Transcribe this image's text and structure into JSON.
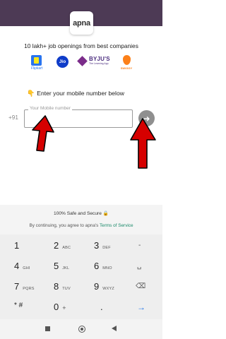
{
  "app": {
    "logo_text": "apna"
  },
  "tagline": "10 lakh+ job openings from best companies",
  "companies": [
    {
      "name": "Flipkart",
      "color": "#2874f0"
    },
    {
      "name": "Jio",
      "color": "#0f3cc9"
    },
    {
      "name": "BYJU'S",
      "subtitle": "The Learning App",
      "color": "#4b2d7f"
    },
    {
      "name": "SWIGGY",
      "color": "#fc8019"
    }
  ],
  "login": {
    "prompt_icon": "pointing-hand-emoji",
    "prompt": "Enter your mobile number below",
    "country_code": "+91",
    "mobile_label": "Your Mobile number",
    "mobile_value": "",
    "submit_icon": "arrow-right-icon"
  },
  "consent": {
    "safe_text": "100% Safe and Secure",
    "lock_icon": "lock-icon",
    "terms_prefix": "By continuing, you agree to apna's",
    "terms_link": "Terms of Service"
  },
  "keypad": {
    "keys": [
      {
        "digit": "1",
        "letters": ""
      },
      {
        "digit": "2",
        "letters": "ABC"
      },
      {
        "digit": "3",
        "letters": "DEF"
      },
      {
        "digit": "-",
        "letters": ""
      },
      {
        "digit": "4",
        "letters": "GHI"
      },
      {
        "digit": "5",
        "letters": "JKL"
      },
      {
        "digit": "6",
        "letters": "MNO"
      },
      {
        "digit": "␣",
        "letters": ""
      },
      {
        "digit": "7",
        "letters": "PQRS"
      },
      {
        "digit": "8",
        "letters": "TUV"
      },
      {
        "digit": "9",
        "letters": "WXYZ"
      },
      {
        "digit": "⌫",
        "letters": ""
      },
      {
        "digit": "* #",
        "letters": ""
      },
      {
        "digit": "0",
        "letters": "+"
      },
      {
        "digit": ".",
        "letters": ""
      },
      {
        "digit": "→",
        "letters": ""
      }
    ]
  },
  "annotations": {
    "arrow_color": "#d60000"
  },
  "navbar": {
    "recents_icon": "square-icon",
    "home_icon": "circle-home-icon",
    "back_icon": "triangle-back-icon"
  }
}
